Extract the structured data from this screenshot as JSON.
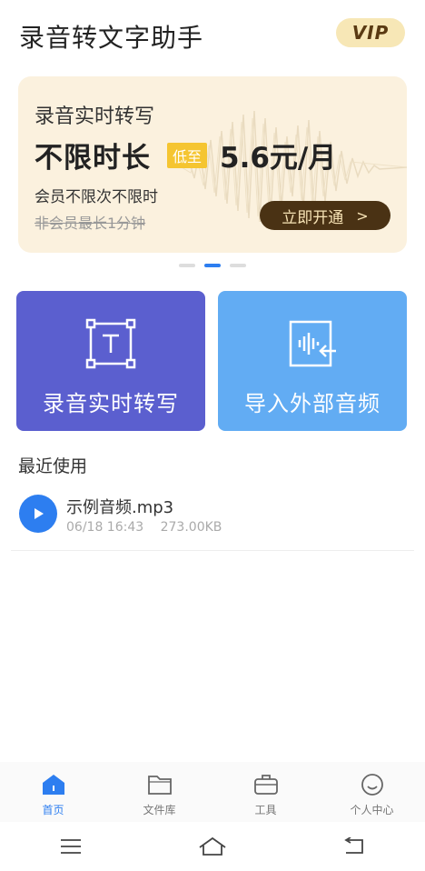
{
  "header": {
    "title": "录音转文字助手",
    "vip_label": "VIP"
  },
  "banner": {
    "title": "录音实时转写",
    "headline": "不限时长",
    "price_tag": "低至",
    "price": "5.6元/月",
    "member_text": "会员不限次不限时",
    "non_member_text": "非会员最长1分钟",
    "cta_label": "立即开通",
    "cta_icon": "chevron-right-icon",
    "slides_total": 3,
    "slide_active": 2
  },
  "cards": [
    {
      "label": "录音实时转写",
      "icon": "text-recognition-icon",
      "color": "#5b5fcf"
    },
    {
      "label": "导入外部音频",
      "icon": "import-audio-icon",
      "color": "#62acf3"
    }
  ],
  "recent": {
    "title": "最近使用",
    "items": [
      {
        "name": "示例音频.mp3",
        "date": "06/18 16:43",
        "size": "273.00KB",
        "icon": "play-icon"
      }
    ]
  },
  "tabbar": {
    "items": [
      {
        "label": "首页",
        "icon": "home-icon",
        "active": true
      },
      {
        "label": "文件库",
        "icon": "folder-icon",
        "active": false
      },
      {
        "label": "工具",
        "icon": "toolbox-icon",
        "active": false
      },
      {
        "label": "个人中心",
        "icon": "smiley-icon",
        "active": false
      }
    ]
  },
  "colors": {
    "accent": "#2d7ef0",
    "vip_gold": "#f7e7b6",
    "cta_brown": "#4a3214"
  }
}
